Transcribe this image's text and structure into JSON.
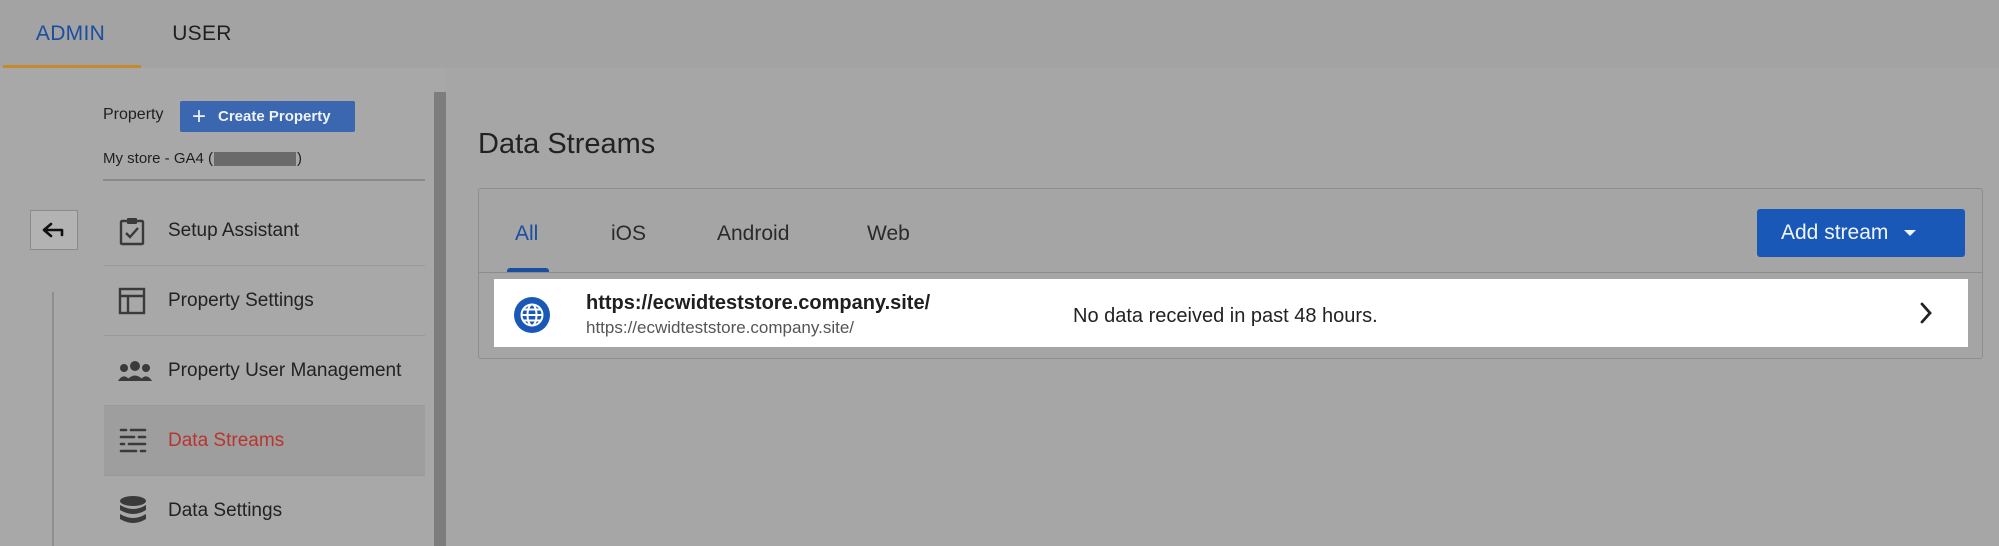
{
  "top_tabs": {
    "admin": "ADMIN",
    "user": "USER"
  },
  "property": {
    "label": "Property",
    "create_button": "Create Property",
    "store_name_prefix": "My store - GA4 (",
    "store_name_suffix": ")"
  },
  "nav": {
    "items": [
      {
        "label": "Setup Assistant",
        "icon": "clipboard-check-icon"
      },
      {
        "label": "Property Settings",
        "icon": "layout-icon"
      },
      {
        "label": "Property User Management",
        "icon": "people-icon"
      },
      {
        "label": "Data Streams",
        "icon": "data-streams-icon",
        "active": true
      },
      {
        "label": "Data Settings",
        "icon": "database-icon"
      }
    ]
  },
  "main": {
    "title": "Data Streams",
    "tabs": [
      "All",
      "iOS",
      "Android",
      "Web"
    ],
    "selected_tab": "All",
    "add_stream_label": "Add stream",
    "streams": [
      {
        "name": "https://ecwidteststore.company.site/",
        "url": "https://ecwidteststore.company.site/",
        "status": "No data received in past 48 hours.",
        "icon": "globe-icon"
      }
    ]
  },
  "colors": {
    "accent_blue": "#1a58b8",
    "active_nav_text": "#b8352e",
    "admin_underline": "#c8892e"
  }
}
